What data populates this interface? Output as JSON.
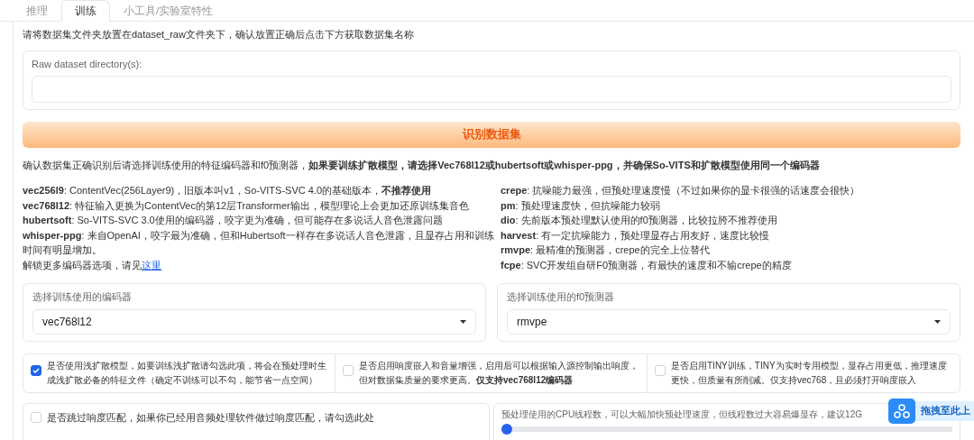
{
  "tabs": [
    {
      "label": "推理",
      "selected": false
    },
    {
      "label": "训练",
      "selected": true
    },
    {
      "label": "小工具/实验室特性",
      "selected": false
    }
  ],
  "instruction": "请将数据集文件夹放置在dataset_raw文件夹下，确认放置正确后点击下方获取数据集名称",
  "dataset_dir": {
    "label": "Raw dataset directory(s):"
  },
  "identify_button": "识别数据集",
  "confirm_text": "确认数据集正确识别后请选择训练使用的特征编码器和f0预测器，**如果要训练扩散模型，请选择Vec768l12或hubertsoft或whisper-ppg，并确保So-VITS和扩散模型使用同一个编码器**",
  "encoders": [
    "**vec256l9**: ContentVec(256Layer9)，旧版本叫v1，So-VITS-SVC 4.0的基础版本，**不推荐使用**",
    "**vec768l12**: 特征输入更换为ContentVec的第12层Transformer输出，模型理论上会更加还原训练集音色",
    "**hubertsoft**: So-VITS-SVC 3.0使用的编码器，咬字更为准确，但可能存在多说话人音色泄露问题",
    "**whisper-ppg**: 来自OpenAI，咬字最为准确，但和Hubertsoft一样存在多说话人音色泄露，且显存占用和训练时间有明显增加。"
  ],
  "more_encoders": {
    "text": "解锁更多编码器选项，请见",
    "link": "这里"
  },
  "f0_predictors": [
    "**crepe**: 抗噪能力最强，但预处理速度慢（不过如果你的显卡很强的话速度会很快）",
    "**pm**: 预处理速度快，但抗噪能力较弱",
    "**dio**: 先前版本预处理默认使用的f0预测器，比较拉胯不推荐使用",
    "**harvest**: 有一定抗噪能力，预处理显存占用友好，速度比较慢",
    "**rmvpe**: 最精准的预测器，crepe的完全上位替代",
    "**fcpe**: SVC开发组自研F0预测器，有最快的速度和不输crepe的精度"
  ],
  "dropdowns": [
    {
      "label": "选择训练使用的编码器",
      "value": "vec768l12"
    },
    {
      "label": "选择训练使用的f0预测器",
      "value": "rmvpe"
    }
  ],
  "options": [
    {
      "label": "是否使用浅扩散模型，如要训练浅扩散请勾选此项，将会在预处理时生成浅扩散必备的特征文件（确定不训练可以不勾，能节省一点空间）",
      "checked": true
    },
    {
      "label": "是否启用响度嵌入和音量增强，启用后可以根据输入源控制输出响度，但对数据集质量的要求更高。**仅支持vec768l12编码器**",
      "checked": false
    },
    {
      "label": "是否启用TINY训练，TINY为实时专用模型，显存占用更低，推理速度更快，但质量有所削减。仅支持vec768，且必须打开响度嵌入",
      "checked": false
    }
  ],
  "skip_loudness": {
    "label": "是否跳过响度匹配，如果你已经用音频处理软件做过响度匹配，请勾选此处",
    "checked": false
  },
  "cpu_threads": {
    "label": "预处理使用的CPU线程数，可以大幅加快预处理速度，但线程数过大容易爆显存，建议12G",
    "level": 0
  },
  "drop_widget": {
    "label": "拖拽至此上"
  }
}
